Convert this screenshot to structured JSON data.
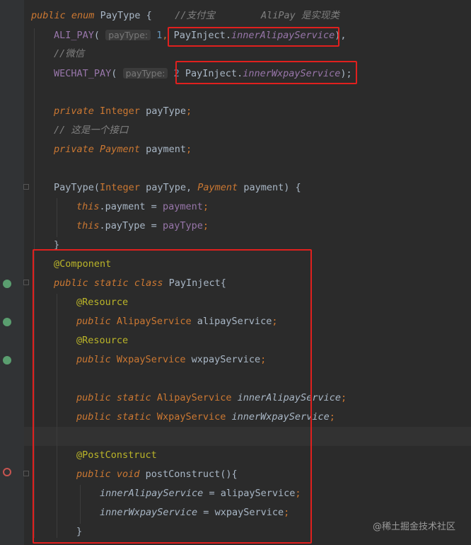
{
  "code": {
    "enum_decl": {
      "public": "public",
      "enum": "enum",
      "name": "PayType",
      "brace": " {",
      "comment": "//支付宝        AliPay 是实现类"
    },
    "ali_pay": {
      "name": "ALI_PAY",
      "open": "(",
      "hint": "payType:",
      "num": "1",
      "sep": ", ",
      "cls": "PayInject",
      "dot": ".",
      "field": "innerAlipayService",
      "close": "),"
    },
    "wechat_comment": "//微信",
    "wechat_pay": {
      "name": "WECHAT_PAY",
      "open": "(",
      "hint": "payType:",
      "num": "2",
      "sep": " ",
      "cls": "PayInject",
      "dot": ".",
      "field": "innerWxpayService",
      "close": ");"
    },
    "field1": {
      "mod": "private",
      "type": "Integer",
      "name": "payType",
      "end": ";"
    },
    "iface_comment": "// 这是一个接口",
    "field2": {
      "mod": "private",
      "type": "Payment",
      "name": "payment",
      "end": ";"
    },
    "ctor": {
      "name": "PayType",
      "p1type": "Integer",
      "p1": "payType",
      "p2type": "Payment",
      "p2": "payment",
      "end": ") {"
    },
    "assign1": {
      "this": "this",
      "field": ".payment",
      "eq": " = ",
      "val": "payment",
      "end": ";"
    },
    "assign2": {
      "this": "this",
      "field": ".payType",
      "eq": " = ",
      "val": "payType",
      "end": ";"
    },
    "close1": "}",
    "annot_component": "@Component",
    "inner_class": {
      "public": "public",
      "static": "static",
      "class": "class",
      "name": "PayInject",
      "brace": "{"
    },
    "annot_res1": "@Resource",
    "f_ali": {
      "mod": "public",
      "type": "AlipayService",
      "name": "alipayService",
      "end": ";"
    },
    "annot_res2": "@Resource",
    "f_wx": {
      "mod": "public",
      "type": "WxpayService",
      "name": "wxpayService",
      "end": ";"
    },
    "sf_ali": {
      "mod": "public",
      "static": "static",
      "type": "AlipayService",
      "name": "innerAlipayService",
      "end": ";"
    },
    "sf_wx": {
      "mod": "public",
      "static": "static",
      "type": "WxpayService",
      "name": "innerWxpayService",
      "end": ";"
    },
    "annot_post": "@PostConstruct",
    "method": {
      "mod": "public",
      "void": "void",
      "name": "postConstruct",
      "end": "(){"
    },
    "m_assign1": {
      "lhs": "innerAlipayService",
      "eq": " = ",
      "rhs": "alipayService",
      "end": ";"
    },
    "m_assign2": {
      "lhs": "innerWxpayService",
      "eq": " = ",
      "rhs": "wxpayService",
      "end": ";"
    },
    "close2": "}"
  },
  "watermark": "@稀土掘金技术社区",
  "colors": {
    "background": "#2b2b2b",
    "keyword": "#cc7832",
    "annotation": "#bbb529",
    "field": "#9876aa",
    "highlight_box": "#e0201e"
  }
}
